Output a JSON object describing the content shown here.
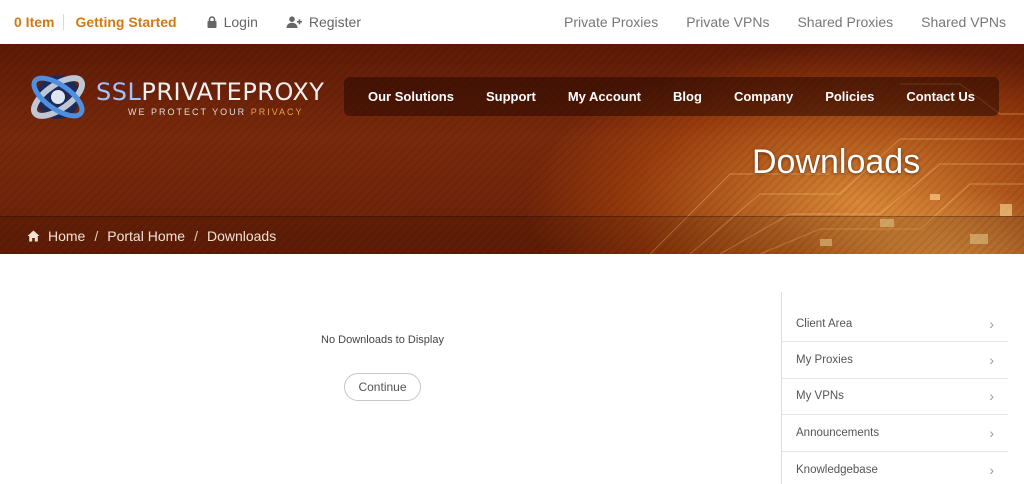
{
  "topbar": {
    "cart": "0 Item",
    "getting_started": "Getting Started",
    "login": "Login",
    "register": "Register",
    "links": [
      "Private Proxies",
      "Private VPNs",
      "Shared Proxies",
      "Shared VPNs"
    ]
  },
  "logo": {
    "name_prefix": "SSL",
    "name_rest": "PRIVATEPROXY",
    "tagline_prefix": "WE PROTECT YOUR ",
    "tagline_highlight": "PRIVACY"
  },
  "nav": [
    "Our Solutions",
    "Support",
    "My Account",
    "Blog",
    "Company",
    "Policies",
    "Contact Us"
  ],
  "page_title": "Downloads",
  "breadcrumb": [
    "Home",
    "Portal Home",
    "Downloads"
  ],
  "breadcrumb_sep": "/",
  "main": {
    "message": "No Downloads to Display",
    "continue_label": "Continue"
  },
  "sidebar": {
    "items": [
      "Client Area",
      "My Proxies",
      "My VPNs",
      "Announcements",
      "Knowledgebase"
    ],
    "chevron": "›"
  },
  "colors": {
    "accent": "#d4790f",
    "header_dark": "#5e1a06"
  }
}
